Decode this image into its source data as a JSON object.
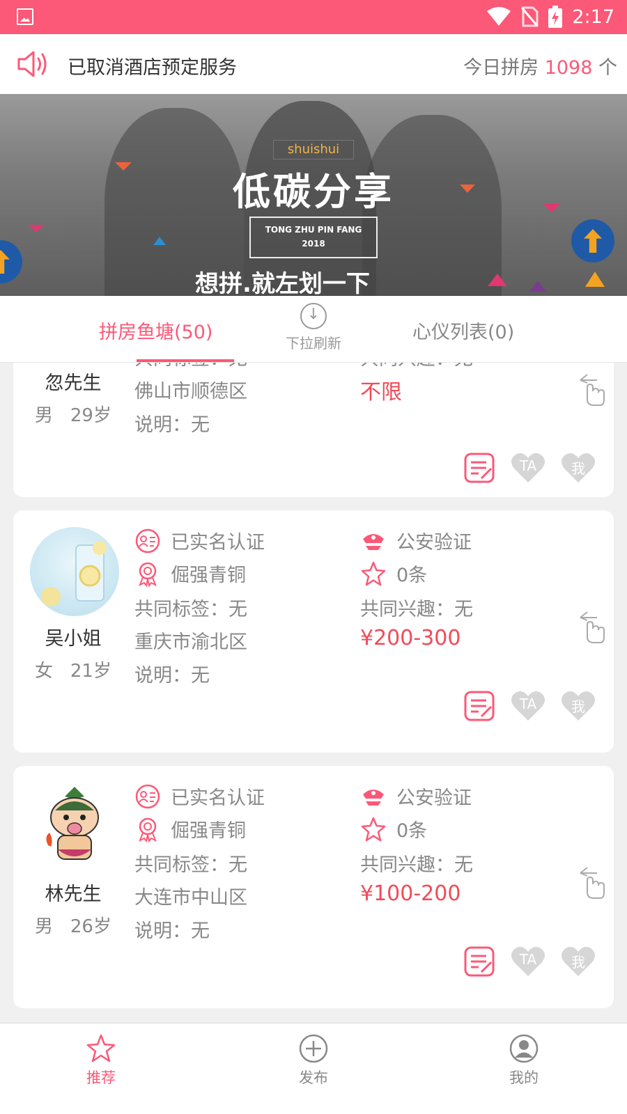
{
  "status_bar": {
    "time": "2:17"
  },
  "notice": {
    "text": "已取消酒店预定服务",
    "today_prefix": "今日拼房",
    "today_count": "1098",
    "today_suffix": "个"
  },
  "banner": {
    "tag": "shuishui",
    "title": "低碳分享",
    "box_line1": "TONG ZHU PIN FANG",
    "box_line2": "2018",
    "slogan": "想拼.就左划一下"
  },
  "tabs": {
    "pond": "拼房鱼塘(50)",
    "refresh": "下拉刷新",
    "wishlist": "心仪列表(0)"
  },
  "cards": [
    {
      "name": "忽先生",
      "gender": "男",
      "age": "29岁",
      "tags": "共同标签：无",
      "interest": "共同兴趣：无",
      "location": "佛山市顺德区",
      "price": "不限",
      "desc": "说明：无"
    },
    {
      "name": "吴小姐",
      "gender": "女",
      "age": "21岁",
      "verify": "已实名认证",
      "police": "公安验证",
      "level": "倔强青铜",
      "count": "0条",
      "tags": "共同标签：无",
      "interest": "共同兴趣：无",
      "location": "重庆市渝北区",
      "price": "¥200-300",
      "desc": "说明：无"
    },
    {
      "name": "林先生",
      "gender": "男",
      "age": "26岁",
      "verify": "已实名认证",
      "police": "公安验证",
      "level": "倔强青铜",
      "count": "0条",
      "tags": "共同标签：无",
      "interest": "共同兴趣：无",
      "location": "大连市中山区",
      "price": "¥100-200",
      "desc": "说明：无"
    }
  ],
  "actions": {
    "ta": "TA",
    "me": "我"
  },
  "bottom_nav": {
    "recommend": "推荐",
    "publish": "发布",
    "mine": "我的"
  },
  "colors": {
    "accent": "#fc5877",
    "price": "#f24a58"
  }
}
